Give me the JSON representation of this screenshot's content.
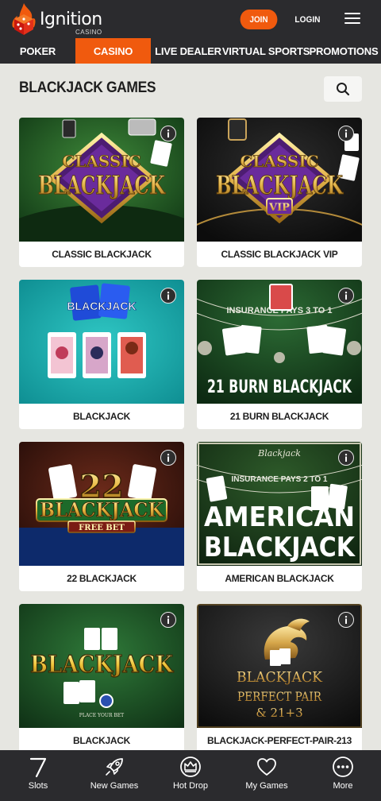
{
  "header": {
    "logo_text": "Ignition",
    "logo_subtext": "CASINO",
    "join_label": "JOIN",
    "login_label": "LOGIN",
    "brand_color": "#f05a0e"
  },
  "nav": {
    "items": [
      {
        "label": "POKER",
        "active": false
      },
      {
        "label": "CASINO",
        "active": true
      },
      {
        "label": "LIVE DEALER",
        "active": false
      },
      {
        "label": "VIRTUAL SPORTS",
        "active": false
      },
      {
        "label": "PROMOTIONS",
        "active": false
      }
    ]
  },
  "section": {
    "title": "BLACKJACK GAMES",
    "search_icon": "search-icon"
  },
  "games": [
    {
      "title": "CLASSIC BLACKJACK",
      "art": {
        "line1": "CLASSIC",
        "line2": "BLACKJACK"
      }
    },
    {
      "title": "CLASSIC BLACKJACK VIP",
      "art": {
        "line1": "CLASSIC",
        "line2": "BLACKJACK",
        "line3": "VIP"
      }
    },
    {
      "title": "BLACKJACK",
      "art": {
        "line1": "BLACKJACK"
      }
    },
    {
      "title": "21 BURN BLACKJACK",
      "art": {
        "line1": "21 BURN BLACKJACK",
        "line2": "INSURANCE PAYS 3 TO 1"
      }
    },
    {
      "title": "22 BLACKJACK",
      "art": {
        "line1": "22",
        "line2": "BLACKJACK",
        "line3": "FREE BET"
      }
    },
    {
      "title": "AMERICAN BLACKJACK",
      "art": {
        "line1": "AMERICAN",
        "line2": "BLACKJACK",
        "line3": "INSURANCE PAYS 2 TO 1",
        "line4": "Blackjack"
      }
    },
    {
      "title": "BLACKJACK",
      "art": {
        "line1": "BLACKJACK",
        "line2": "PLACE YOUR BET"
      }
    },
    {
      "title": "BLACKJACK-PERFECT-PAIR-213",
      "art": {
        "line1": "BLACKJACK",
        "line2": "PERFECT PAIR",
        "line3": "& 21+3"
      }
    }
  ],
  "bottom_nav": [
    {
      "label": "Slots",
      "icon": "slots-icon"
    },
    {
      "label": "New Games",
      "icon": "rocket-icon"
    },
    {
      "label": "Hot Drop",
      "icon": "crown-icon"
    },
    {
      "label": "My Games",
      "icon": "heart-icon"
    },
    {
      "label": "More",
      "icon": "more-icon"
    }
  ]
}
